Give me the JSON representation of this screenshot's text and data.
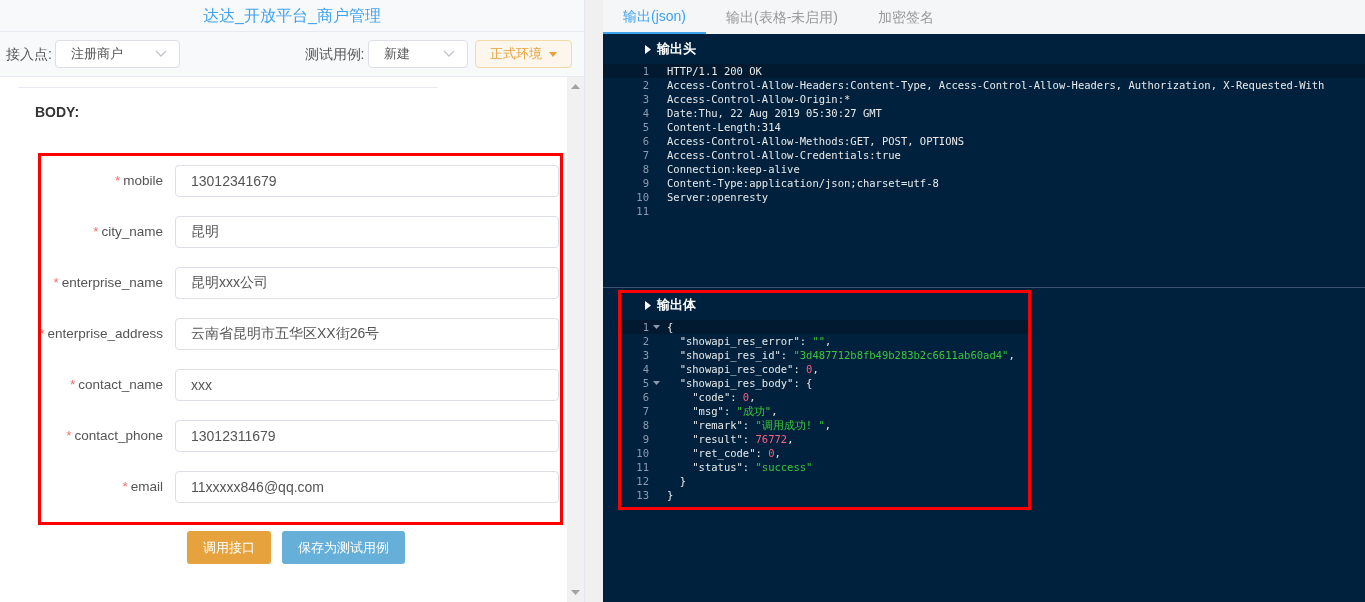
{
  "app_title": "达达_开放平台_商户管理",
  "toolbar": {
    "access_label": "接入点:",
    "access_value": "注册商户",
    "case_label": "测试用例:",
    "case_value": "新建",
    "env_button": "正式环境"
  },
  "body_label": "BODY:",
  "form": {
    "highlighted": true,
    "fields": [
      {
        "required_mark": "*",
        "label": "mobile",
        "value": "13012341679"
      },
      {
        "required_mark": "*",
        "label": "city_name",
        "value": "昆明"
      },
      {
        "required_mark": "*",
        "label": "enterprise_name",
        "value": "昆明xxx公司"
      },
      {
        "required_mark": "*",
        "label": "enterprise_address",
        "value": "云南省昆明市五华区XX街26号"
      },
      {
        "required_mark": "*",
        "label": "contact_name",
        "value": "xxx"
      },
      {
        "required_mark": "*",
        "label": "contact_phone",
        "value": "13012311679"
      },
      {
        "required_mark": "*",
        "label": "email",
        "value": "11xxxxx846@qq.com"
      }
    ]
  },
  "buttons": [
    {
      "label": "调用接口",
      "kind": "primary"
    },
    {
      "label": "保存为测试用例",
      "kind": "secondary"
    }
  ],
  "tabs": [
    {
      "label": "输出(json)",
      "selected": true
    },
    {
      "label": "输出(表格-未启用)",
      "selected": false
    },
    {
      "label": "加密签名",
      "selected": false
    }
  ],
  "output_header": {
    "title": "输出头",
    "lines": [
      {
        "number": "1",
        "active": true,
        "foldable": false,
        "segments": [
          {
            "text": "HTTP/1.1 200 OK",
            "kind": "plain"
          }
        ]
      },
      {
        "number": "2",
        "active": false,
        "foldable": false,
        "segments": [
          {
            "text": "Access-Control-Allow-Headers:Content-Type, Access-Control-Allow-Headers, Authorization, X-Requested-With",
            "kind": "plain"
          }
        ]
      },
      {
        "number": "3",
        "active": false,
        "foldable": false,
        "segments": [
          {
            "text": "Access-Control-Allow-Origin:*",
            "kind": "plain"
          }
        ]
      },
      {
        "number": "4",
        "active": false,
        "foldable": false,
        "segments": [
          {
            "text": "Date:Thu, 22 Aug 2019 05:30:27 GMT",
            "kind": "plain"
          }
        ]
      },
      {
        "number": "5",
        "active": false,
        "foldable": false,
        "segments": [
          {
            "text": "Content-Length:314",
            "kind": "plain"
          }
        ]
      },
      {
        "number": "6",
        "active": false,
        "foldable": false,
        "segments": [
          {
            "text": "Access-Control-Allow-Methods:GET, POST, OPTIONS",
            "kind": "plain"
          }
        ]
      },
      {
        "number": "7",
        "active": false,
        "foldable": false,
        "segments": [
          {
            "text": "Access-Control-Allow-Credentials:true",
            "kind": "plain"
          }
        ]
      },
      {
        "number": "8",
        "active": false,
        "foldable": false,
        "segments": [
          {
            "text": "Connection:keep-alive",
            "kind": "plain"
          }
        ]
      },
      {
        "number": "9",
        "active": false,
        "foldable": false,
        "segments": [
          {
            "text": "Content-Type:application/json;charset=utf-8",
            "kind": "plain"
          }
        ]
      },
      {
        "number": "10",
        "active": false,
        "foldable": false,
        "segments": [
          {
            "text": "Server:openresty",
            "kind": "plain"
          }
        ]
      },
      {
        "number": "11",
        "active": false,
        "foldable": false
      }
    ]
  },
  "output_body": {
    "title": "输出体",
    "highlighted": true,
    "lines": [
      {
        "number": "1",
        "active": true,
        "foldable": true,
        "segments": [
          {
            "text": "{",
            "kind": "plain"
          }
        ]
      },
      {
        "number": "2",
        "active": false,
        "foldable": false,
        "segments": [
          {
            "text": "  \"showapi_res_error\": ",
            "kind": "plain"
          },
          {
            "text": "\"\"",
            "kind": "string"
          },
          {
            "text": ",",
            "kind": "plain"
          }
        ]
      },
      {
        "number": "3",
        "active": false,
        "foldable": false,
        "segments": [
          {
            "text": "  \"showapi_res_id\": ",
            "kind": "plain"
          },
          {
            "text": "\"3d487712b8fb49b283b2c6611ab60ad4\"",
            "kind": "string"
          },
          {
            "text": ",",
            "kind": "plain"
          }
        ]
      },
      {
        "number": "4",
        "active": false,
        "foldable": false,
        "segments": [
          {
            "text": "  \"showapi_res_code\": ",
            "kind": "plain"
          },
          {
            "text": "0",
            "kind": "number"
          },
          {
            "text": ",",
            "kind": "plain"
          }
        ]
      },
      {
        "number": "5",
        "active": false,
        "foldable": true,
        "segments": [
          {
            "text": "  \"showapi_res_body\": {",
            "kind": "plain"
          }
        ]
      },
      {
        "number": "6",
        "active": false,
        "foldable": false,
        "segments": [
          {
            "text": "    \"code\": ",
            "kind": "plain"
          },
          {
            "text": "0",
            "kind": "number"
          },
          {
            "text": ",",
            "kind": "plain"
          }
        ]
      },
      {
        "number": "7",
        "active": false,
        "foldable": false,
        "segments": [
          {
            "text": "    \"msg\": ",
            "kind": "plain"
          },
          {
            "text": "\"成功\"",
            "kind": "string"
          },
          {
            "text": ",",
            "kind": "plain"
          }
        ]
      },
      {
        "number": "8",
        "active": false,
        "foldable": false,
        "segments": [
          {
            "text": "    \"remark\": ",
            "kind": "plain"
          },
          {
            "text": "\"调用成功! \"",
            "kind": "string"
          },
          {
            "text": ",",
            "kind": "plain"
          }
        ]
      },
      {
        "number": "9",
        "active": false,
        "foldable": false,
        "segments": [
          {
            "text": "    \"result\": ",
            "kind": "plain"
          },
          {
            "text": "76772",
            "kind": "number"
          },
          {
            "text": ",",
            "kind": "plain"
          }
        ]
      },
      {
        "number": "10",
        "active": false,
        "foldable": false,
        "segments": [
          {
            "text": "    \"ret_code\": ",
            "kind": "plain"
          },
          {
            "text": "0",
            "kind": "number"
          },
          {
            "text": ",",
            "kind": "plain"
          }
        ]
      },
      {
        "number": "11",
        "active": false,
        "foldable": false,
        "segments": [
          {
            "text": "    \"status\": ",
            "kind": "plain"
          },
          {
            "text": "\"success\"",
            "kind": "string"
          }
        ]
      },
      {
        "number": "12",
        "active": false,
        "foldable": false,
        "segments": [
          {
            "text": "  }",
            "kind": "plain"
          }
        ]
      },
      {
        "number": "13",
        "active": false,
        "foldable": false,
        "segments": [
          {
            "text": "}",
            "kind": "plain"
          }
        ]
      }
    ]
  }
}
